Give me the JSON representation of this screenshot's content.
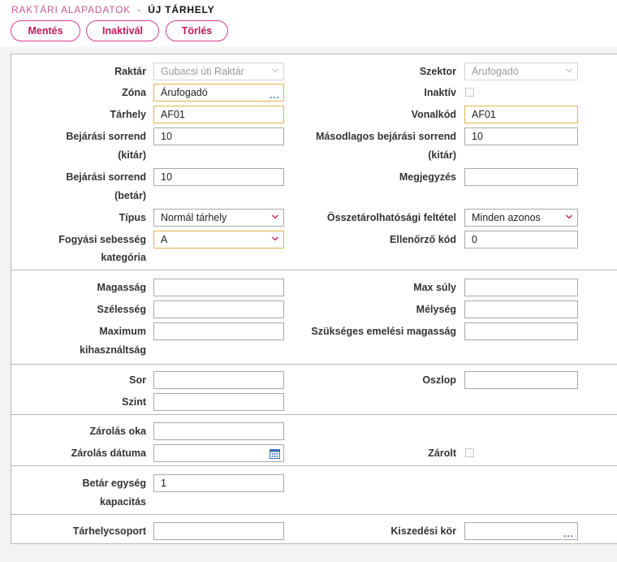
{
  "breadcrumb": {
    "parent": "RAKTÁRI ALAPADATOK",
    "separator": "-",
    "current": "ÚJ TÁRHELY"
  },
  "toolbar": {
    "save": "Mentés",
    "inactivate": "Inaktivál",
    "delete": "Törlés"
  },
  "form": {
    "raktar": {
      "label": "Raktár",
      "value": "Gubacsi úti Raktár"
    },
    "szektor": {
      "label": "Szektor",
      "value": "Árufogadó"
    },
    "zona": {
      "label": "Zóna",
      "value": "Árufogadó",
      "lookup": "..."
    },
    "inaktiv": {
      "label": "Inaktív",
      "checked": false
    },
    "tarhely": {
      "label": "Tárhely",
      "value": "AF01"
    },
    "vonalkod": {
      "label": "Vonalkód",
      "value": "AF01"
    },
    "bejarasi_kitar": {
      "label_line1": "Bejárási sorrend",
      "label_line2": "(kitár)",
      "value": "10"
    },
    "masodlagos": {
      "label_line1": "Másodlagos bejárási sorrend",
      "label_line2": "(kitár)",
      "value": "10"
    },
    "bejarasi_betar": {
      "label_line1": "Bejárási sorrend",
      "label_line2": "(betár)",
      "value": "10"
    },
    "megjegyzes": {
      "label": "Megjegyzés",
      "value": ""
    },
    "tipus": {
      "label": "Típus",
      "value": "Normál tárhely"
    },
    "osszetarolhatosagi": {
      "label": "Összetárolhatósági feltétel",
      "value": "Minden azonos"
    },
    "fogyasi": {
      "label_line1": "Fogyási sebesség",
      "label_line2": "kategória",
      "value": "A"
    },
    "ellenorzo": {
      "label": "Ellenőrző kód",
      "value": "0"
    },
    "magassag": {
      "label": "Magasság",
      "value": ""
    },
    "max_suly": {
      "label": "Max súly",
      "value": ""
    },
    "szelesseg": {
      "label": "Szélesség",
      "value": ""
    },
    "melyseg": {
      "label": "Mélység",
      "value": ""
    },
    "max_kihasznaltsag": {
      "label_line1": "Maximum",
      "label_line2": "kihasználtság",
      "value": ""
    },
    "emelesi": {
      "label": "Szükséges emelési magasság",
      "value": ""
    },
    "sor": {
      "label": "Sor",
      "value": ""
    },
    "oszlop": {
      "label": "Oszlop",
      "value": ""
    },
    "szint": {
      "label": "Szint",
      "value": ""
    },
    "zarolas_oka": {
      "label": "Zárolás oka",
      "value": ""
    },
    "zarolas_datuma": {
      "label": "Zárolás dátuma",
      "value": ""
    },
    "zarolt": {
      "label": "Zárolt",
      "checked": false
    },
    "betar_kapacitas": {
      "label_line1": "Betár egység",
      "label_line2": "kapacitás",
      "value": "1"
    },
    "tarhelycsoport": {
      "label": "Tárhelycsoport",
      "value": ""
    },
    "kiszedesi_kor": {
      "label": "Kiszedési kör",
      "value": "",
      "lookup": "..."
    }
  },
  "colors": {
    "accent": "#c2185b",
    "required_border": "#e3b34c",
    "icon_blue": "#3b6fb6"
  },
  "icons": {
    "dropdown": "chevron-down-icon",
    "lookup": "ellipsis-icon",
    "calendar": "calendar-icon"
  }
}
